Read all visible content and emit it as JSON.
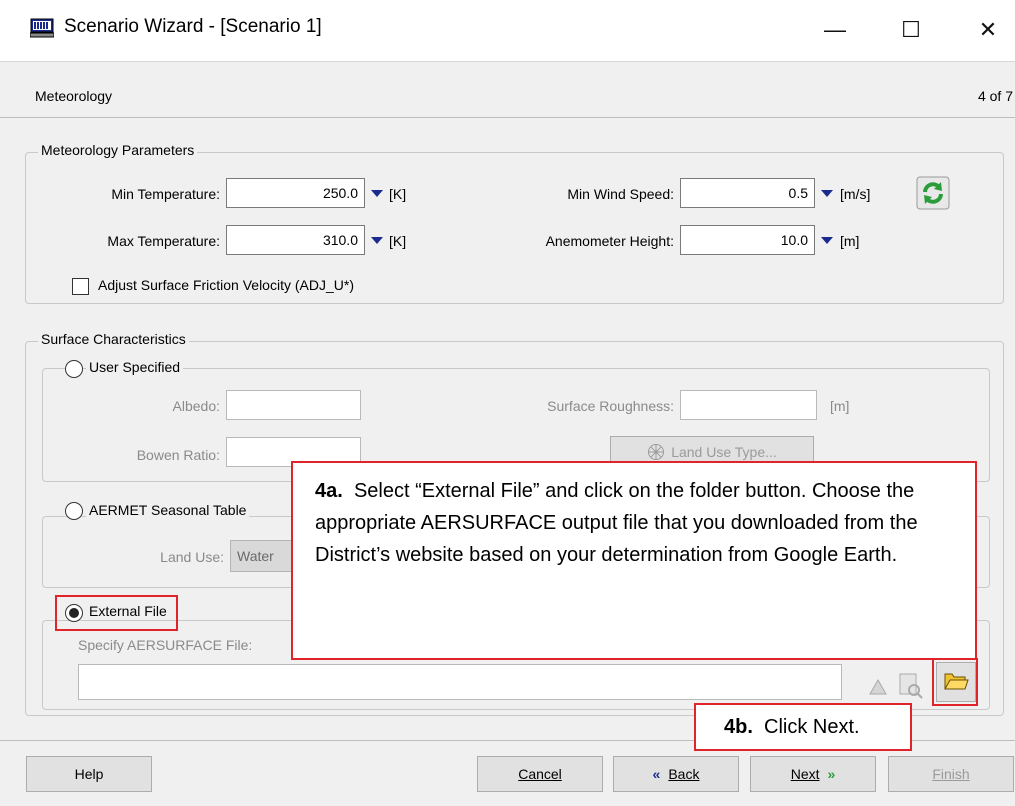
{
  "window": {
    "title": "Scenario Wizard - [Scenario 1]",
    "controls": {
      "minimize": "—",
      "maximize": "☐",
      "close": "✕"
    }
  },
  "header": {
    "title": "Meteorology",
    "step": "4 of 7"
  },
  "met_params": {
    "group_title": "Meteorology Parameters",
    "min_temp": {
      "label": "Min Temperature:",
      "value": "250.0",
      "unit": "[K]"
    },
    "max_temp": {
      "label": "Max Temperature:",
      "value": "310.0",
      "unit": "[K]"
    },
    "min_wind": {
      "label": "Min Wind Speed:",
      "value": "0.5",
      "unit": "[m/s]"
    },
    "anemometer": {
      "label": "Anemometer Height:",
      "value": "10.0",
      "unit": "[m]"
    },
    "adj_u": {
      "label": "Adjust Surface Friction Velocity (ADJ_U*)",
      "checked": false
    }
  },
  "surface": {
    "group_title": "Surface Characteristics",
    "user_specified": {
      "label": "User Specified",
      "albedo_label": "Albedo:",
      "bowen_label": "Bowen Ratio:",
      "roughness_label": "Surface Roughness:",
      "roughness_unit": "[m]",
      "land_use_btn": "Land Use Type..."
    },
    "aermet": {
      "label": "AERMET Seasonal Table",
      "land_use_label": "Land Use:",
      "land_use_value": "Water"
    },
    "external": {
      "label": "External File",
      "selected": true,
      "file_label": "Specify AERSURFACE File:",
      "file_value": ""
    }
  },
  "callout_a": {
    "bold": "4a.",
    "text": "Select “External File” and click on the folder button.  Choose the appropriate AERSURFACE output file that you downloaded from the District’s website based on your determination from Google Earth."
  },
  "callout_b": {
    "bold": "4b.",
    "text": "Click Next."
  },
  "footer": {
    "help": "Help",
    "cancel": "Cancel",
    "back": "Back",
    "next": "Next",
    "finish": "Finish"
  },
  "colors": {
    "accent_red": "#e0242b",
    "arrow_blue": "#1b2a8f",
    "refresh_green": "#2a9d3a"
  }
}
